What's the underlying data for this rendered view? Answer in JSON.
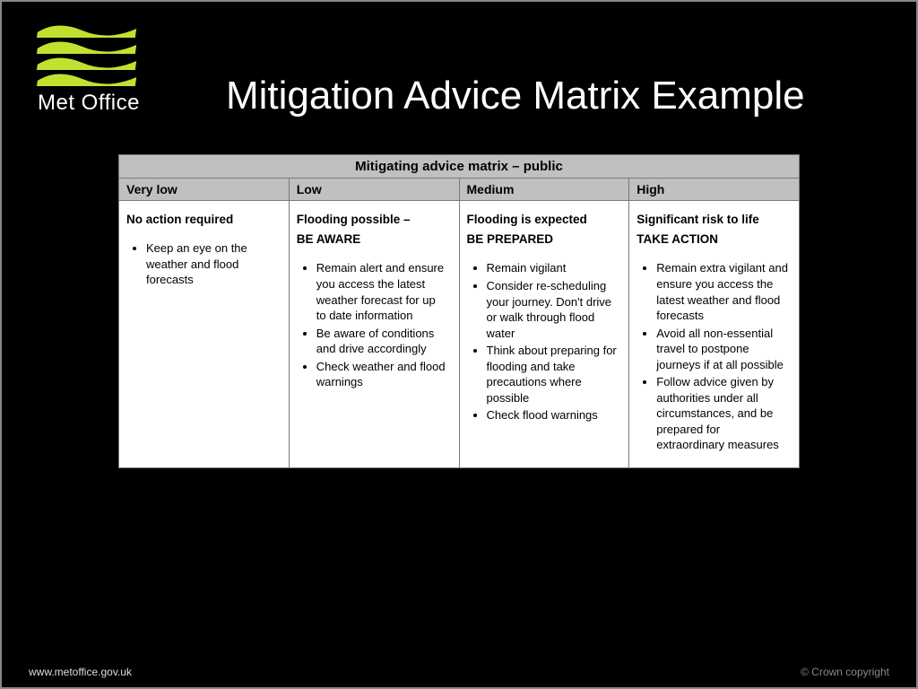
{
  "brand": {
    "name": "Met Office",
    "accent": "#c1e12f"
  },
  "slide": {
    "title": "Mitigation Advice Matrix Example"
  },
  "matrix": {
    "caption": "Mitigating advice matrix – public",
    "columns": [
      {
        "level": "Very low",
        "summary_line1": "No action required",
        "summary_line2": "",
        "bullets": [
          "Keep an eye on the weather and flood forecasts"
        ]
      },
      {
        "level": "Low",
        "summary_line1": "Flooding possible –",
        "summary_line2": "BE AWARE",
        "bullets": [
          "Remain alert and ensure you access the latest weather forecast for up to date information",
          "Be aware of conditions and drive accordingly",
          "Check weather and flood warnings"
        ]
      },
      {
        "level": "Medium",
        "summary_line1": "Flooding is expected",
        "summary_line2": "BE PREPARED",
        "bullets": [
          "Remain vigilant",
          "Consider re-scheduling your journey. Don't drive or walk through flood water",
          "Think about preparing for flooding and take precautions where possible",
          "Check flood warnings"
        ]
      },
      {
        "level": "High",
        "summary_line1": "Significant risk to life",
        "summary_line2": "TAKE ACTION",
        "bullets": [
          "Remain extra vigilant and ensure you access the latest weather and flood forecasts",
          "Avoid all non-essential travel to postpone journeys if at all possible",
          "Follow advice given by authorities under all circumstances, and be prepared for extraordinary measures"
        ]
      }
    ]
  },
  "footer": {
    "url": "www.metoffice.gov.uk",
    "copyright": "© Crown copyright"
  }
}
